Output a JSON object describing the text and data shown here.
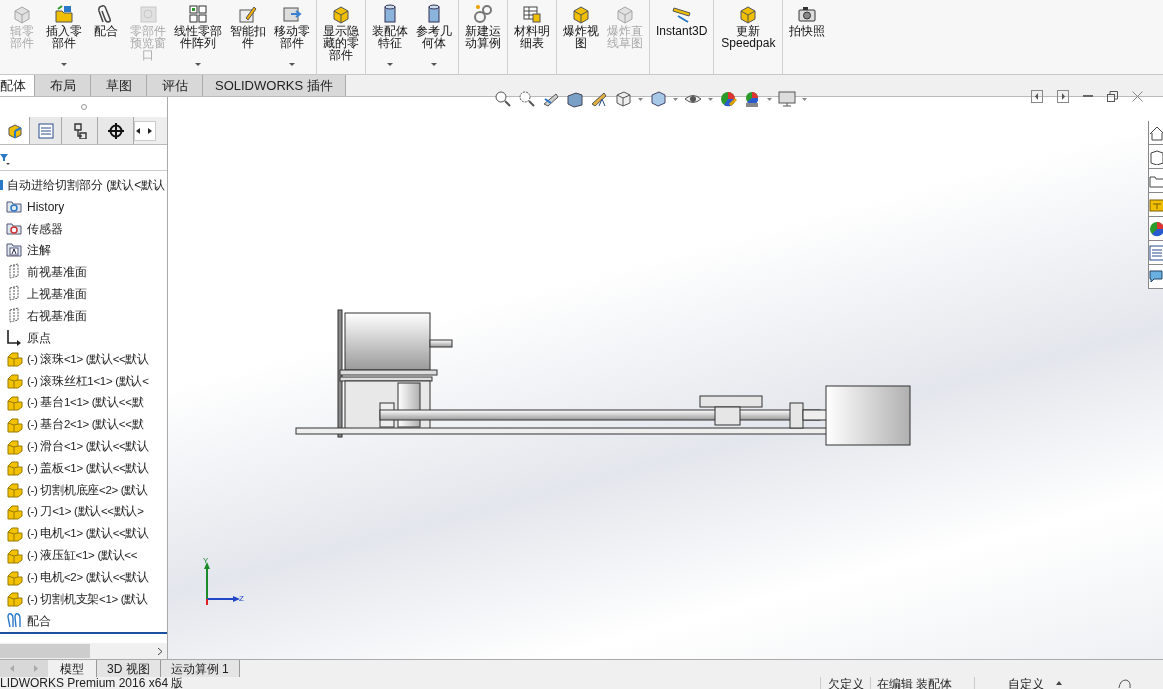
{
  "toolbar_groups": [
    [
      {
        "label": "辑零部件",
        "disabled": true,
        "dropdown": false
      },
      {
        "label": "插入零部件",
        "disabled": false,
        "dropdown": true
      },
      {
        "label": "配合",
        "disabled": false,
        "dropdown": false
      },
      {
        "label": "零部件预览窗口",
        "disabled": true,
        "dropdown": false
      },
      {
        "label": "线性零部件阵列",
        "disabled": false,
        "dropdown": true
      },
      {
        "label": "智能扣件",
        "disabled": false,
        "dropdown": false
      },
      {
        "label": "移动零部件",
        "disabled": false,
        "dropdown": true
      }
    ],
    [
      {
        "label": "显示隐藏的零部件",
        "disabled": false,
        "dropdown": false
      }
    ],
    [
      {
        "label": "装配体特征",
        "disabled": false,
        "dropdown": true
      },
      {
        "label": "参考几何体",
        "disabled": false,
        "dropdown": true
      }
    ],
    [
      {
        "label": "新建运动算例",
        "disabled": false,
        "dropdown": false
      }
    ],
    [
      {
        "label": "材料明细表",
        "disabled": false,
        "dropdown": false
      }
    ],
    [
      {
        "label": "爆炸视图",
        "disabled": false,
        "dropdown": false
      },
      {
        "label": "爆炸直线草图",
        "disabled": true,
        "dropdown": false
      }
    ],
    [
      {
        "label": "Instant3D",
        "disabled": false,
        "dropdown": false
      }
    ],
    [
      {
        "label": "更新Speedpak",
        "disabled": false,
        "dropdown": false
      }
    ],
    [
      {
        "label": "拍快照",
        "disabled": false,
        "dropdown": false
      }
    ]
  ],
  "tabs": [
    {
      "label": "配体",
      "selected": true
    },
    {
      "label": "布局",
      "selected": false
    },
    {
      "label": "草图",
      "selected": false
    },
    {
      "label": "评估",
      "selected": false
    },
    {
      "label": "SOLIDWORKS 插件",
      "selected": false
    }
  ],
  "panel_tabs": [
    {
      "selected": true
    },
    {
      "selected": false
    },
    {
      "selected": false
    },
    {
      "selected": false
    }
  ],
  "tree": {
    "label": "自动进给切割部分 (默认<默认",
    "children": [
      {
        "kind": "history",
        "label": "History"
      },
      {
        "kind": "sensor",
        "label": "传感器"
      },
      {
        "kind": "annotation",
        "label": "注解"
      },
      {
        "kind": "plane",
        "label": "前视基准面"
      },
      {
        "kind": "plane",
        "label": "上视基准面"
      },
      {
        "kind": "plane",
        "label": "右视基准面"
      },
      {
        "kind": "origin",
        "label": "原点"
      },
      {
        "kind": "part",
        "label": "(-) 滚珠<1> (默认<<默认"
      },
      {
        "kind": "part",
        "label": "(-) 滚珠丝杠1<1> (默认<"
      },
      {
        "kind": "part",
        "label": "(-) 基台1<1> (默认<<默"
      },
      {
        "kind": "part",
        "label": "(-) 基台2<1> (默认<<默"
      },
      {
        "kind": "part",
        "label": "(-) 滑台<1> (默认<<默认"
      },
      {
        "kind": "part",
        "label": "(-) 盖板<1> (默认<<默认"
      },
      {
        "kind": "part",
        "label": "(-) 切割机底座<2> (默认"
      },
      {
        "kind": "part",
        "label": "(-) 刀<1> (默认<<默认>"
      },
      {
        "kind": "part",
        "label": "(-) 电机<1> (默认<<默认"
      },
      {
        "kind": "part",
        "label": "(-) 液压缸<1> (默认<<"
      },
      {
        "kind": "part",
        "label": "(-) 电机<2> (默认<<默认"
      },
      {
        "kind": "part",
        "label": "(-) 切割机支架<1> (默认"
      },
      {
        "kind": "mate",
        "label": "配合"
      }
    ]
  },
  "triad_labels": [
    "Y",
    "Z"
  ],
  "bottom_tabs": [
    {
      "label": "模型",
      "selected": true
    },
    {
      "label": "3D 视图",
      "selected": false
    },
    {
      "label": "运动算例 1",
      "selected": false
    }
  ],
  "status_bar": {
    "product": "LIDWORKS Premium 2016 x64 版",
    "fields": [
      "欠定义",
      "在编辑 装配体",
      "自定义"
    ]
  }
}
